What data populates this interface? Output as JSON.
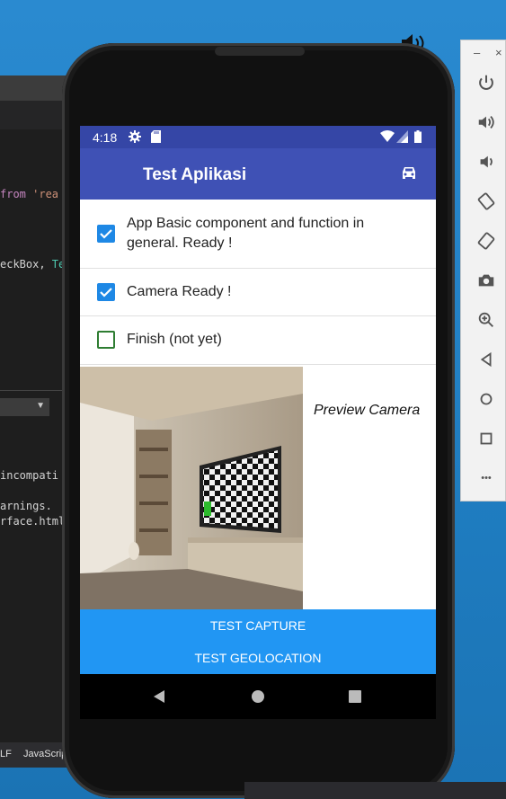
{
  "editor": {
    "code_lines": [
      {
        "kw": "from",
        "str": " 'rea"
      },
      {
        "text": "eckBox, ",
        "ty": "Te"
      }
    ],
    "dropdown_arrow": "▼",
    "output_lines": [
      "incompati",
      "arnings.",
      "rface.html"
    ],
    "status": {
      "eol": "LF",
      "language": "JavaScrip"
    }
  },
  "emulator_toolbar": {
    "minimize": "–",
    "close": "×",
    "items": [
      "power-icon",
      "volume-up-icon",
      "volume-down-icon",
      "rotate-left-icon",
      "rotate-right-icon",
      "camera-icon",
      "zoom-icon",
      "back-icon",
      "home-icon",
      "overview-icon",
      "more-icon"
    ],
    "more_label": "•••"
  },
  "phone": {
    "status_bar": {
      "time": "4:18"
    },
    "app_bar": {
      "title": "Test Aplikasi"
    },
    "checklist": [
      {
        "label": "App Basic component and function in general. Ready !",
        "checked": true
      },
      {
        "label": "Camera Ready !",
        "checked": true
      },
      {
        "label": "Finish (not yet)",
        "checked": false
      }
    ],
    "preview_caption": "Preview Camera",
    "buttons": {
      "capture": "TEST CAPTURE",
      "geolocation": "TEST GEOLOCATION"
    }
  },
  "colors": {
    "status_bar": "#3546a6",
    "app_bar": "#3f51b5",
    "button": "#2196f3",
    "checkbox_on": "#1e88e5",
    "checkbox_off": "#2e7d32"
  }
}
